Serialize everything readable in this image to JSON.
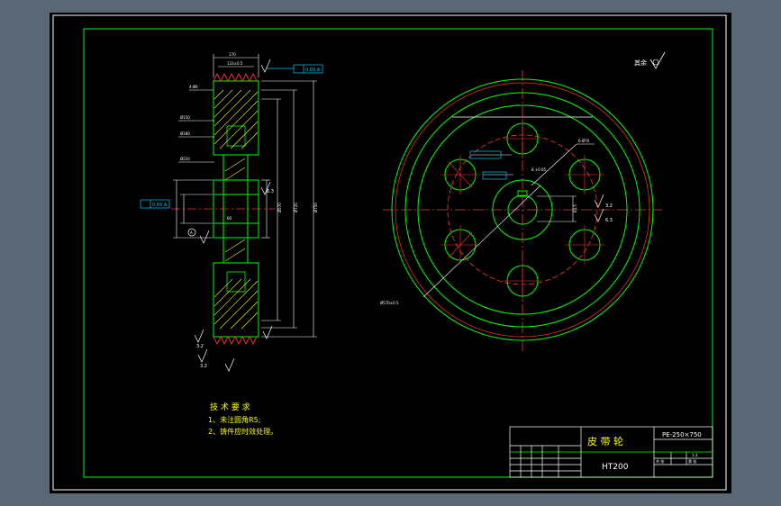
{
  "drawing": {
    "colors": {
      "background": "#000000",
      "window": "#5b6774",
      "frame": "#ffffff",
      "border": "#00ff00",
      "centerline": "#ff3030",
      "hatch": "#ffff00",
      "dimension": "#ffffff",
      "annotation": "#00c8ff",
      "text_blue": "#4aa8ff"
    },
    "top_right_note": "其余",
    "tech_requirements": {
      "title": "技 术 要 求",
      "item1": "1、未注圆角R5;",
      "item2": "2、铸件应时效处理。"
    },
    "title_block": {
      "part_name": "皮 带 轮",
      "drawing_no": "PE-250×750",
      "material": "HT200",
      "scale": "1:3",
      "row_label_1": "共  张",
      "row_label_2": "第  张"
    },
    "dims": {
      "roughness_a": "3.2",
      "roughness_b": "6.3",
      "roughness_c": "3.2",
      "tol_box_top": "0.03 A",
      "tol_box_left": "0.03 A",
      "datum": "A"
    }
  }
}
